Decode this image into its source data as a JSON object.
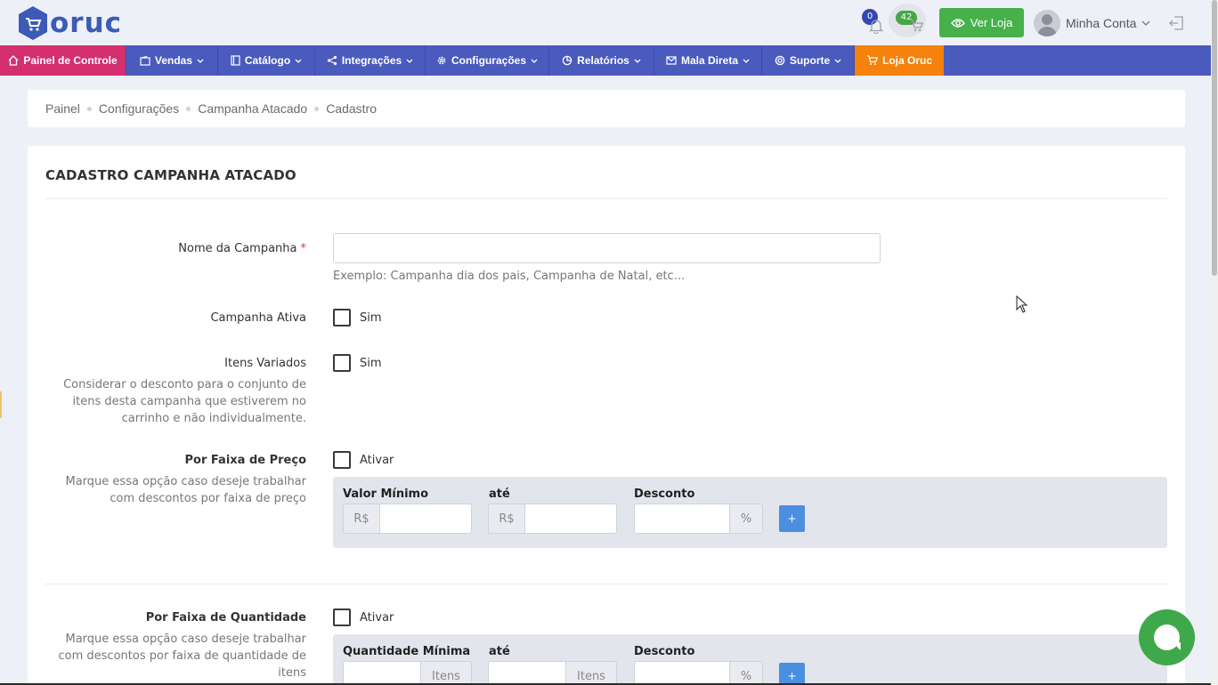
{
  "header": {
    "logo_text": "oruc",
    "notifications_count": "0",
    "cart_count": "42",
    "view_store_label": "Ver Loja",
    "account_label": "Minha Conta"
  },
  "nav": {
    "items": [
      {
        "label": "Painel de Controle",
        "icon": "home-icon"
      },
      {
        "label": "Vendas",
        "icon": "wallet-icon"
      },
      {
        "label": "Catálogo",
        "icon": "book-icon"
      },
      {
        "label": "Integrações",
        "icon": "share-icon"
      },
      {
        "label": "Configurações",
        "icon": "gear-icon"
      },
      {
        "label": "Relatórios",
        "icon": "pie-icon"
      },
      {
        "label": "Mala Direta",
        "icon": "mail-icon"
      },
      {
        "label": "Suporte",
        "icon": "lifebuoy-icon"
      },
      {
        "label": "Loja Oruc",
        "icon": "cart-icon"
      }
    ],
    "colors": {
      "bar": "#4a5bbd",
      "active": "#d42f6e",
      "store": "#f5820d"
    }
  },
  "breadcrumb": [
    "Painel",
    "Configurações",
    "Campanha Atacado",
    "Cadastro"
  ],
  "form": {
    "title": "CADASTRO CAMPANHA ATACADO",
    "name": {
      "label": "Nome da Campanha",
      "required_mark": "*",
      "value": "",
      "help": "Exemplo: Campanha dia dos pais, Campanha de Natal, etc..."
    },
    "active": {
      "label": "Campanha Ativa",
      "option": "Sim",
      "checked": false
    },
    "varied": {
      "label": "Itens Variados",
      "option": "Sim",
      "checked": false,
      "desc": "Considerar o desconto para o conjunto de itens desta campanha que estiverem no carrinho e não individualmente."
    },
    "price_range": {
      "label": "Por Faixa de Preço",
      "option": "Ativar",
      "checked": false,
      "desc": "Marque essa opção caso deseje trabalhar com descontos por faixa de preço",
      "col_min": "Valor Mínimo",
      "col_to": "até",
      "col_discount": "Desconto",
      "currency": "R$",
      "percent": "%",
      "add_label": "+"
    },
    "qty_range": {
      "label": "Por Faixa de Quantidade",
      "option": "Ativar",
      "checked": false,
      "desc": "Marque essa opção caso deseje trabalhar com descontos por faixa de quantidade de itens",
      "col_min": "Quantidade Mínima",
      "col_to": "até",
      "col_discount": "Desconto",
      "unit": "Itens",
      "percent": "%",
      "add_label": "+"
    }
  }
}
